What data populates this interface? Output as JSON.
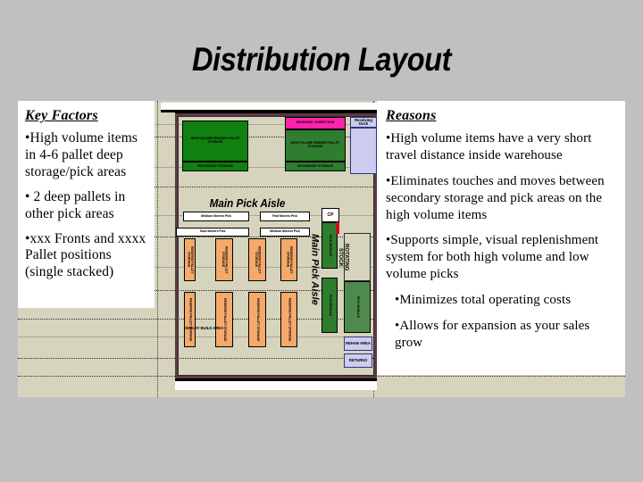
{
  "slide": {
    "title": "Distribution Layout",
    "background_color": "#c0c0c0",
    "sheet_color": "#d6d4bd"
  },
  "key_factors": {
    "heading": "Key Factors",
    "bullets": [
      "•High volume items in 4-6 pallet deep storage/pick areas",
      "• 2 deep pallets in other pick areas",
      "•xxx Fronts and xxxx Pallet positions (single stacked)"
    ]
  },
  "reasons": {
    "heading": "Reasons",
    "bullets": [
      "•High volume items have a very short travel distance inside warehouse",
      "•Eliminates touches and moves between secondary storage and pick areas on the high volume items",
      "•Supports simple, visual replenishment system for both high volume and low volume picks",
      "•Minimizes total operating costs",
      "•Allows for expansion as your sales grow"
    ]
  },
  "diagram": {
    "name": "warehouse-floor-plan",
    "main_pick_aisle_horizontal": "Main Pick Aisle",
    "main_pick_aisle_vertical": "Main Pick Aisle",
    "rotating_stock": "ROTATING STOCK",
    "receiving_dock": "Receiving Dock",
    "cp_label": "CP",
    "colors": {
      "high_volume_green": "#108010",
      "secondary_green": "#2f7d2f",
      "receiving_magenta": "#ff22aa",
      "rack_orange": "#f5a96a",
      "dock_lavender": "#ccccf0",
      "wall_maroon": "#5c3a44"
    },
    "top_blocks": [
      {
        "name": "high-volume-pick-left",
        "label": "HIGH VOLUME\nPRIMARY\nPALLET STORAGE",
        "color": "green"
      },
      {
        "name": "secondary-storage-left",
        "label": "SECONDARY STORAGE",
        "color": "green"
      },
      {
        "name": "receiving-inspection",
        "label": "RECEIVING /\nINSPECTION",
        "color": "magenta"
      },
      {
        "name": "high-volume-pick-right",
        "label": "HIGH VOLUME\nPRIMARY\nPALLET STORAGE",
        "color": "green2"
      },
      {
        "name": "secondary-storage-right",
        "label": "SECONDARY STORAGE",
        "color": "green2"
      }
    ],
    "aisle_label_boxes": [
      {
        "name": "aisle-box-1",
        "label": "Medium   Movers Pick"
      },
      {
        "name": "aisle-box-2",
        "label": "Fast Movers Pick"
      },
      {
        "name": "aisle-box-3",
        "label": "Slow Movers Pick"
      },
      {
        "name": "aisle-box-4",
        "label": "Medium Movers Pick"
      }
    ],
    "rack_rows": [
      {
        "name": "rack-row-upper",
        "count": 4,
        "label": "RESERVE PALLET STORAGE"
      },
      {
        "name": "rack-row-lower",
        "count": 4,
        "label": "RESERVE PALLET STORAGE"
      }
    ],
    "right_blocks": [
      {
        "name": "cp-box",
        "label": "CP"
      },
      {
        "name": "green-column-1",
        "label": "PICK MODULE"
      },
      {
        "name": "green-column-2",
        "label": "PICK MODULE"
      },
      {
        "name": "green-column-3",
        "label": "PICK MODULE"
      },
      {
        "name": "green-column-4",
        "label": "PICK MODULE"
      }
    ],
    "bottom_boxes": [
      {
        "name": "display-area",
        "label": "DISPLAY\nBUILD\nAREA"
      },
      {
        "name": "rehab-area",
        "label": "REHAB AREA"
      },
      {
        "name": "returns-area",
        "label": "RETURNS"
      }
    ]
  }
}
